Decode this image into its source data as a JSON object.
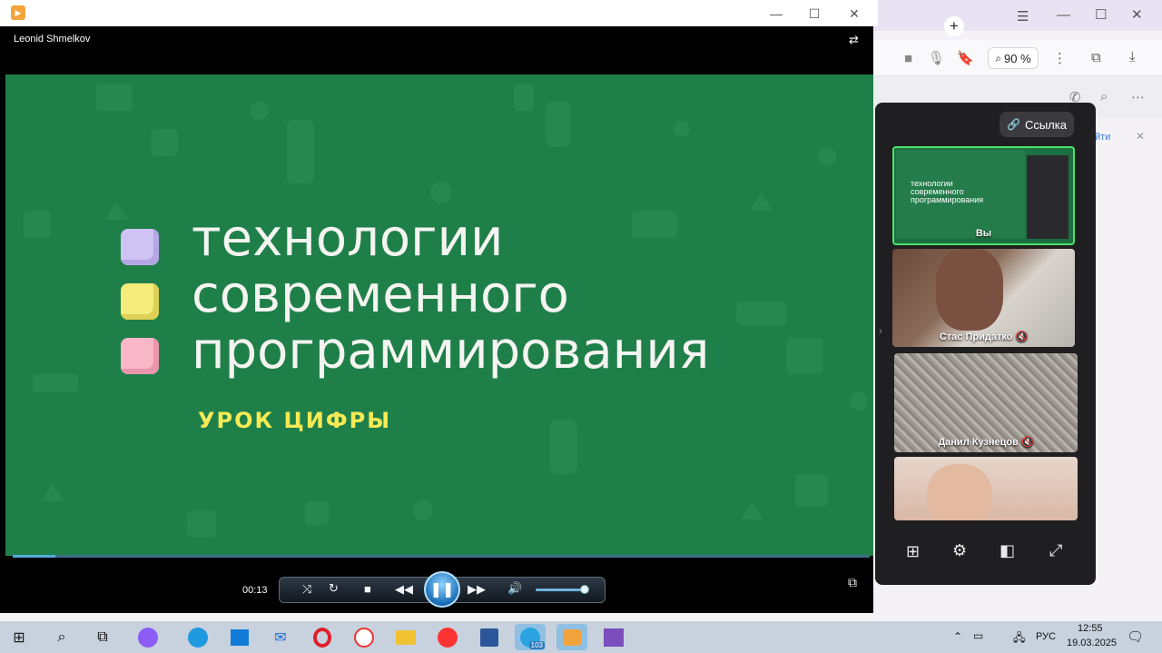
{
  "player": {
    "owner_name": "Leonid Shmelkov",
    "elapsed_time": "00:13",
    "progress_fraction": 0.05,
    "volume_fraction": 0.95,
    "slide": {
      "line1": "технологии",
      "line2": "современного",
      "line3": "программирования",
      "subtitle": "урок цифры"
    }
  },
  "browser": {
    "zoom_label": "90 %",
    "partial_link": "йти"
  },
  "call": {
    "link_button": "Ссылка",
    "participants": [
      {
        "name": "Вы",
        "self": true
      },
      {
        "name": "Стас Придатко",
        "muted": true
      },
      {
        "name": "Данил Кузнецов",
        "muted": true
      },
      {
        "name": "",
        "muted": false
      }
    ]
  },
  "taskbar": {
    "language": "РУС",
    "time": "12:55",
    "date": "19.03.2025",
    "telegram_badge": "103"
  },
  "colors": {
    "slide_green": "#1f7f49",
    "active_tile_border": "#4be36a",
    "accent_blue": "#1b6fb8"
  }
}
